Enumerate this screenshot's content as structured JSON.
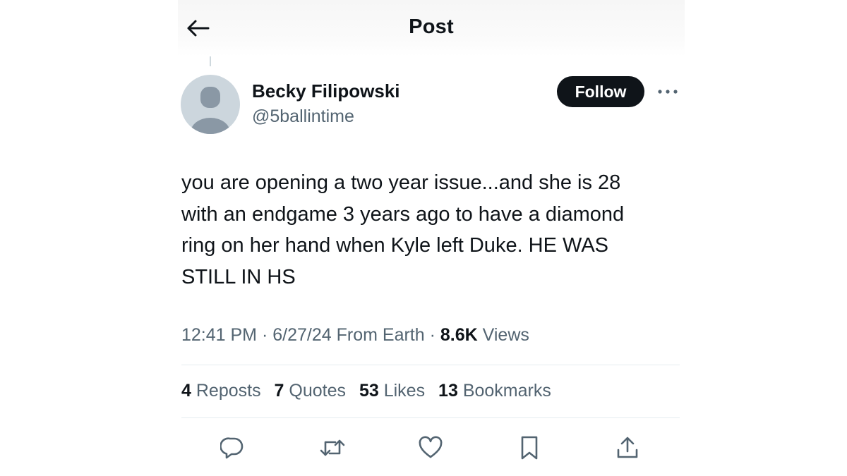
{
  "header": {
    "title": "Post",
    "back_icon": "arrow-left-icon"
  },
  "author": {
    "name": "Becky Filipowski",
    "handle": "@5ballintime",
    "avatar_icon": "default-avatar-icon",
    "follow_label": "Follow",
    "more_icon": "more-horizontal-icon"
  },
  "tweet": {
    "lines": [
      "you are opening a two year issue...and she is 28",
      "with an endgame 3 years ago to have a diamond",
      "ring on her hand when Kyle left Duke. HE WAS",
      "STILL IN HS"
    ]
  },
  "meta": {
    "time": "12:41 PM",
    "sep1": "·",
    "date": "6/27/24",
    "source": "From Earth",
    "sep2": "·",
    "views_count": "8.6K",
    "views_label": "Views"
  },
  "stats": {
    "reposts": {
      "count": "4",
      "label": "Reposts"
    },
    "quotes": {
      "count": "7",
      "label": "Quotes"
    },
    "likes": {
      "count": "53",
      "label": "Likes"
    },
    "bookmarks": {
      "count": "13",
      "label": "Bookmarks"
    }
  },
  "actions": [
    {
      "icon": "reply-icon"
    },
    {
      "icon": "repost-icon"
    },
    {
      "icon": "like-icon"
    },
    {
      "icon": "bookmark-icon"
    },
    {
      "icon": "share-icon"
    }
  ],
  "colors": {
    "text_primary": "#0f1419",
    "text_secondary": "#536471",
    "divider": "#e6ecf0",
    "avatar_bg": "#ccd6dd",
    "avatar_fg": "#8a98a5"
  }
}
